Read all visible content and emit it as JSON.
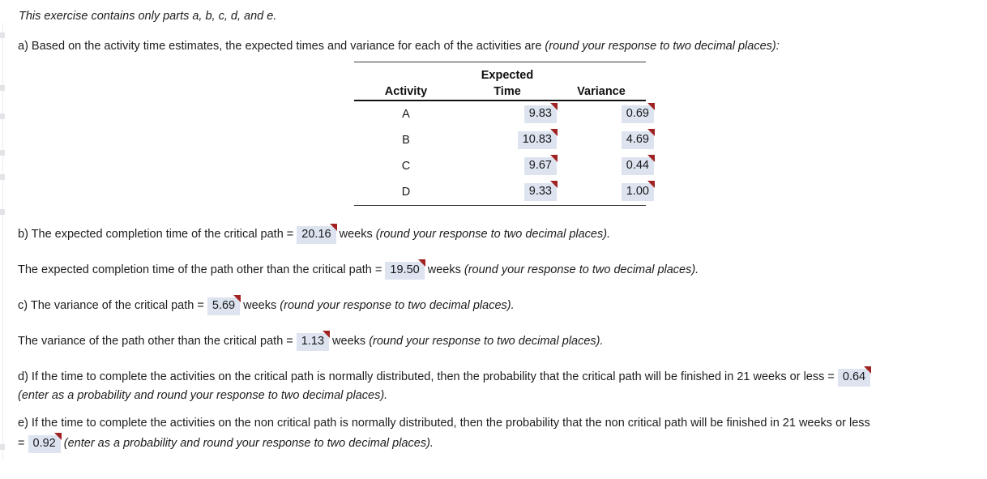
{
  "intro": {
    "note": "This exercise contains only parts a, b, c, d, and e."
  },
  "part_a": {
    "prompt_main": "a) Based on the activity time estimates, the expected times and variance for each of the activities are ",
    "prompt_italic": "(round your response to two decimal places):",
    "table": {
      "headers": {
        "activity": "Activity",
        "expected_line1": "Expected",
        "expected_line2": "Time",
        "variance": "Variance"
      },
      "rows": [
        {
          "activity": "A",
          "expected_time": "9.83",
          "variance": "0.69"
        },
        {
          "activity": "B",
          "expected_time": "10.83",
          "variance": "4.69"
        },
        {
          "activity": "C",
          "expected_time": "9.67",
          "variance": "0.44"
        },
        {
          "activity": "D",
          "expected_time": "9.33",
          "variance": "1.00"
        }
      ]
    }
  },
  "part_b": {
    "line1_pre": "b) The expected completion time of the critical path = ",
    "line1_value": "20.16",
    "line1_mid": " weeks ",
    "line1_italic": "(round your response to two decimal places).",
    "line2_pre": "The expected completion time of the path other than the critical path =  ",
    "line2_value": "19.50",
    "line2_mid": " weeks ",
    "line2_italic": "(round your response to two decimal places)."
  },
  "part_c": {
    "line1_pre": "c) The variance of the critical path = ",
    "line1_value": "5.69",
    "line1_mid": " weeks ",
    "line1_italic": "(round your response to two decimal places).",
    "line2_pre": "The variance of the path other than the critical path = ",
    "line2_value": "1.13",
    "line2_mid": " weeks ",
    "line2_italic": "(round your response to two decimal places)."
  },
  "part_d": {
    "line1_pre": "d) If the time to complete the activities on the critical path is normally distributed, then the probability that the critical path will be finished in 21 weeks or less = ",
    "line1_value": "0.64",
    "line2_italic": "(enter as a probability and round your response to two decimal places)."
  },
  "part_e": {
    "line1": "e) If the time to complete the activities on the non critical path is normally distributed, then the probability that the non critical path will be finished in 21 weeks or less",
    "line2_pre": "=  ",
    "line2_value": "0.92",
    "line2_italic": " (enter as a probability and round your response to two decimal places)."
  },
  "colors": {
    "answer_box_bg": "#dde4ef",
    "answer_flag": "#a02222",
    "text": "#1d1d1d",
    "rule": "#111111"
  }
}
